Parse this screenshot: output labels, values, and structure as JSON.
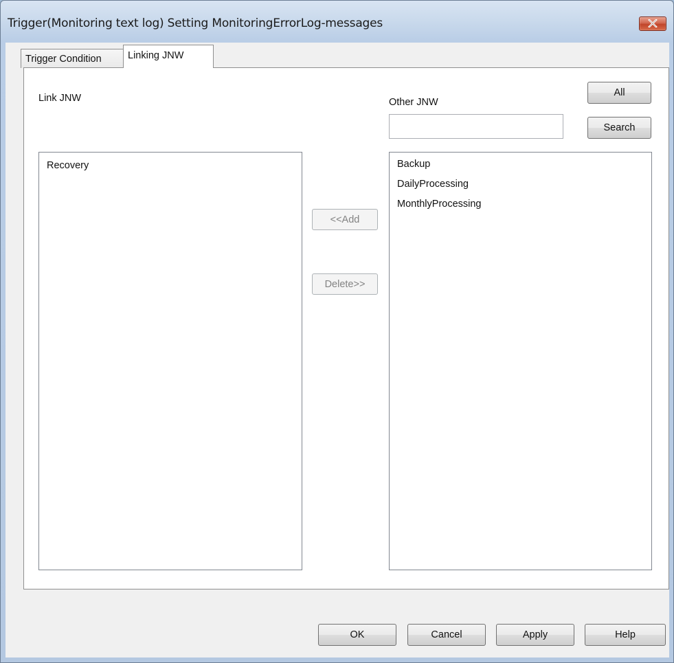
{
  "window": {
    "title": "Trigger(Monitoring text log) Setting MonitoringErrorLog-messages"
  },
  "tabs": [
    {
      "label": "Trigger Condition",
      "active": false
    },
    {
      "label": "Linking JNW",
      "active": true
    }
  ],
  "link_panel": {
    "label": "Link JNW",
    "items": [
      "Recovery"
    ]
  },
  "other_panel": {
    "label": "Other JNW",
    "all_label": "All",
    "search_label": "Search",
    "search_value": "",
    "items": [
      "Backup",
      "DailyProcessing",
      "MonthlyProcessing"
    ]
  },
  "transfer": {
    "add_label": "<<Add",
    "delete_label": "Delete>>"
  },
  "footer": {
    "ok_label": "OK",
    "cancel_label": "Cancel",
    "apply_label": "Apply",
    "help_label": "Help"
  },
  "colors": {
    "close_button": "#c0452a",
    "frame": "#b4c8e1"
  }
}
